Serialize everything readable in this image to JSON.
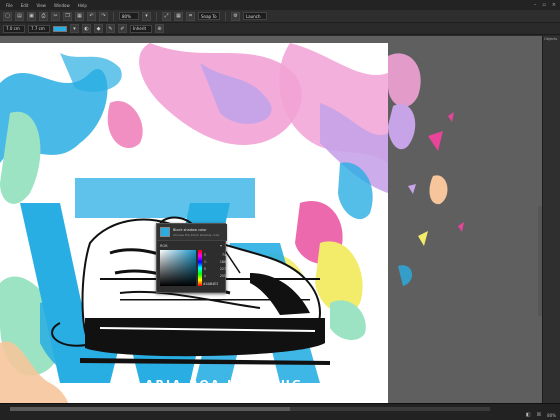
{
  "menu": {
    "items": [
      "File",
      "Edit",
      "View",
      "Window",
      "Help"
    ]
  },
  "toolbar1": {
    "zoom": "80%",
    "snap_label": "Snap To",
    "launch_label": "Launch"
  },
  "toolbar2": {
    "width_value": "7.0 cm",
    "height_value": "7.7 cm",
    "stroke_label": "Inherit",
    "fill_color": "#29aee3"
  },
  "artwork": {
    "caption": "ARIA-BOA JUNE BUG",
    "colors": {
      "cyan": "#29aee3",
      "pink": "#f2a2d6",
      "magenta": "#e8449a",
      "mint": "#9be3c3",
      "yellow": "#f2ec6a",
      "lavender": "#c7a3e8",
      "peach": "#f6c59b"
    }
  },
  "color_popup": {
    "title": "Block shadow color",
    "subtitle": "Choose the block shadow color",
    "mode": "RGB",
    "values": [
      {
        "key": "R",
        "value": "74"
      },
      {
        "key": "G",
        "value": "180"
      },
      {
        "key": "B",
        "value": "227"
      },
      {
        "key": "A",
        "value": "255"
      }
    ],
    "hex": "#4AB4E3",
    "current_color": "#29aee3"
  },
  "right_panel": {
    "tab_label": "Objects"
  },
  "status": {
    "zoom": "80%"
  }
}
